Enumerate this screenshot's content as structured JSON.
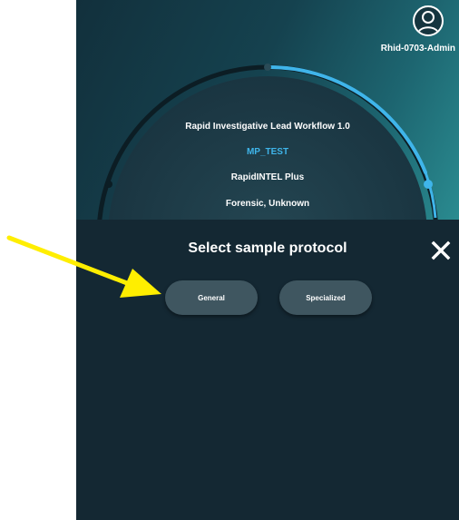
{
  "header": {
    "username": "Rhid-0703-Admin"
  },
  "run_info": {
    "workflow": "Rapid Investigative Lead Workflow 1.0",
    "sample_name": "MP_TEST",
    "kit": "RapidINTEL Plus",
    "sample_type": "Forensic, Unknown"
  },
  "dialog": {
    "title": "Select sample protocol",
    "options": [
      {
        "label": "General"
      },
      {
        "label": "Specialized"
      }
    ]
  },
  "colors": {
    "accent": "#3fb5ea",
    "annotation_arrow": "#ffee00",
    "sheet_background": "#142833",
    "pill_background": "#3f5660"
  },
  "icons": {
    "avatar": "user-avatar-icon",
    "close": "close-icon",
    "annotation": "arrow-pointer-icon"
  }
}
